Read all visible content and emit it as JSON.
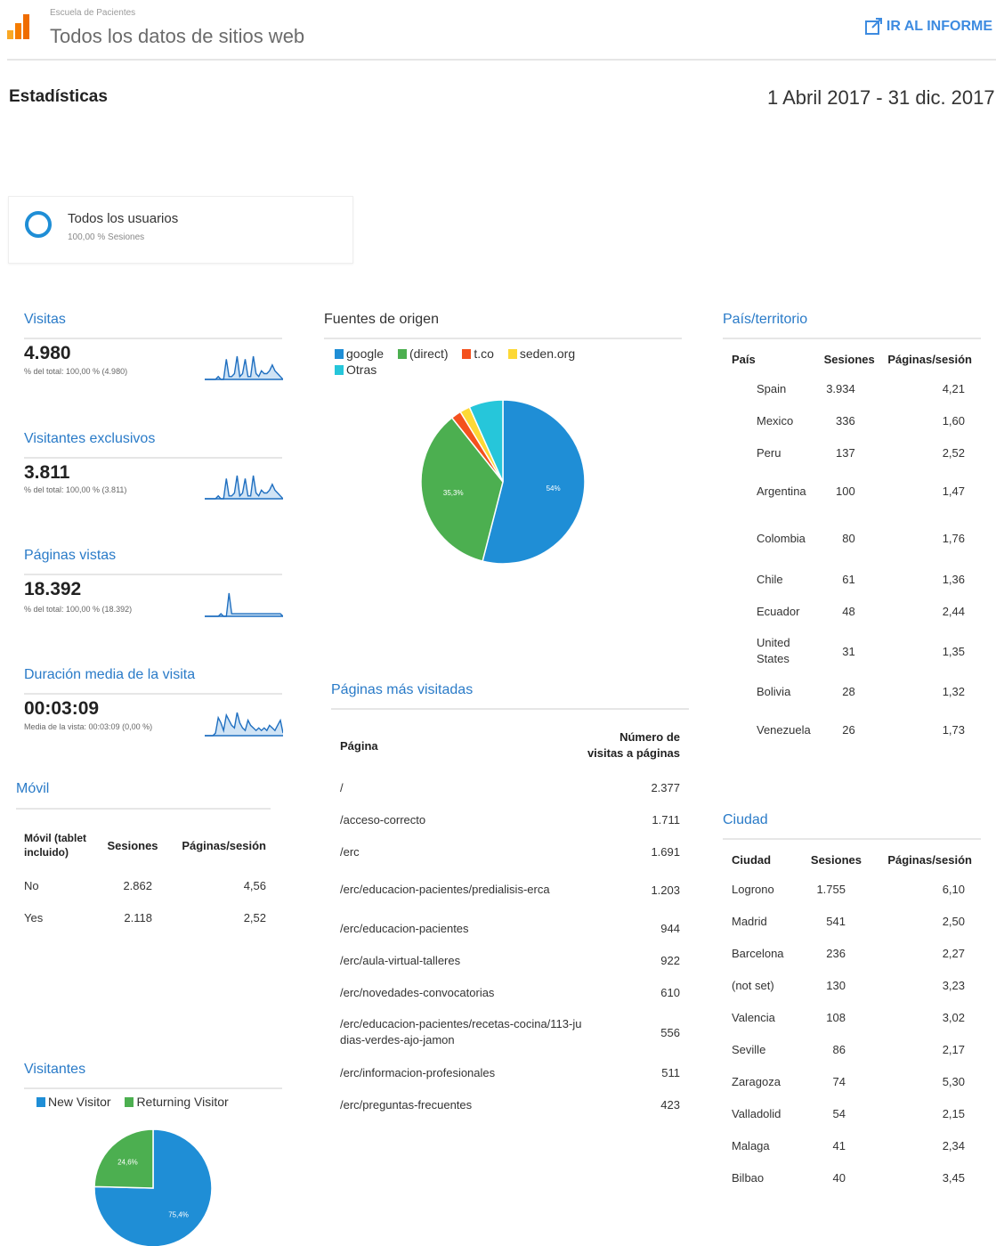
{
  "header": {
    "subtitle": "Escuela de Pacientes",
    "title": "Todos los datos de sitios web",
    "report_link": "IR AL INFORME"
  },
  "stats_label": "Estadísticas",
  "date_range": "1 Abril 2017 - 31 dic. 2017",
  "segment": {
    "name": "Todos los usuarios",
    "pct": "100,00 % Sesiones"
  },
  "metrics": [
    {
      "title": "Visitas",
      "value": "4.980",
      "sub": "% del total: 100,00 % (4.980)"
    },
    {
      "title": "Visitantes exclusivos",
      "value": "3.811",
      "sub": "% del total: 100,00 % (3.811)"
    },
    {
      "title": "Páginas vistas",
      "value": "18.392",
      "sub": "% del total: 100,00 % (18.392)"
    },
    {
      "title": "Duración media de la visita",
      "value": "00:03:09",
      "sub": "Media de la vista: 00:03:09 (0,00 %)"
    }
  ],
  "mobile": {
    "title": "Móvil",
    "headers": [
      "Móvil (tablet incluido)",
      "Sesiones",
      "Páginas/sesión"
    ],
    "rows": [
      [
        "No",
        "2.862",
        "4,56"
      ],
      [
        "Yes",
        "2.118",
        "2,52"
      ]
    ]
  },
  "visitors": {
    "title": "Visitantes",
    "legend": [
      "New Visitor",
      "Returning Visitor"
    ],
    "colors": [
      "#1f8ed6",
      "#4caf50"
    ]
  },
  "sources": {
    "title": "Fuentes de origen",
    "legend": [
      "google",
      "(direct)",
      "t.co",
      "seden.org",
      "Otras"
    ],
    "colors": [
      "#1f8ed6",
      "#4caf50",
      "#f4511e",
      "#fdd835",
      "#26c6da"
    ]
  },
  "top_pages": {
    "title": "Páginas más visitadas",
    "headers": [
      "Página",
      "Número de visitas a páginas"
    ],
    "rows": [
      [
        "/",
        "2.377"
      ],
      [
        "/acceso-correcto",
        "1.711"
      ],
      [
        "/erc",
        "1.691"
      ],
      [
        "/erc/educacion-pacientes/predialisis-erca",
        "1.203"
      ],
      [
        "/erc/educacion-pacientes",
        "944"
      ],
      [
        "/erc/aula-virtual-talleres",
        "922"
      ],
      [
        "/erc/novedades-convocatorias",
        "610"
      ],
      [
        "/erc/educacion-pacientes/recetas-cocina/113-judias-verdes-ajo-jamon",
        "556"
      ],
      [
        "/erc/informacion-profesionales",
        "511"
      ],
      [
        "/erc/preguntas-frecuentes",
        "423"
      ]
    ]
  },
  "country": {
    "title": "País/territorio",
    "headers": [
      "País",
      "Sesiones",
      "Páginas/sesión"
    ],
    "rows": [
      [
        "Spain",
        "3.934",
        "4,21"
      ],
      [
        "Mexico",
        "336",
        "1,60"
      ],
      [
        "Peru",
        "137",
        "2,52"
      ],
      [
        "Argentina",
        "100",
        "1,47"
      ],
      [
        "Colombia",
        "80",
        "1,76"
      ],
      [
        "Chile",
        "61",
        "1,36"
      ],
      [
        "Ecuador",
        "48",
        "2,44"
      ],
      [
        "United States",
        "31",
        "1,35"
      ],
      [
        "Bolivia",
        "28",
        "1,32"
      ],
      [
        "Venezuela",
        "26",
        "1,73"
      ]
    ]
  },
  "city": {
    "title": "Ciudad",
    "headers": [
      "Ciudad",
      "Sesiones",
      "Páginas/sesión"
    ],
    "rows": [
      [
        "Logrono",
        "1.755",
        "6,10"
      ],
      [
        "Madrid",
        "541",
        "2,50"
      ],
      [
        "Barcelona",
        "236",
        "2,27"
      ],
      [
        "(not set)",
        "130",
        "3,23"
      ],
      [
        "Valencia",
        "108",
        "3,02"
      ],
      [
        "Seville",
        "86",
        "2,17"
      ],
      [
        "Zaragoza",
        "74",
        "5,30"
      ],
      [
        "Valladolid",
        "54",
        "2,15"
      ],
      [
        "Malaga",
        "41",
        "2,34"
      ],
      [
        "Bilbao",
        "40",
        "3,45"
      ]
    ]
  },
  "chart_data": [
    {
      "type": "pie",
      "title": "Fuentes de origen",
      "categories": [
        "google",
        "(direct)",
        "t.co",
        "seden.org",
        "Otras"
      ],
      "values": [
        54,
        35.3,
        2,
        2,
        6.7
      ],
      "labels": [
        "54%",
        "35,3%",
        "",
        "",
        ""
      ]
    },
    {
      "type": "pie",
      "title": "Visitantes",
      "categories": [
        "New Visitor",
        "Returning Visitor"
      ],
      "values": [
        75.4,
        24.6
      ],
      "labels": [
        "75,4%",
        "24,6%"
      ]
    },
    {
      "type": "line",
      "title": "Visitas",
      "values": [
        0,
        0,
        0,
        0,
        0,
        1,
        0,
        0,
        7,
        1,
        1,
        2,
        8,
        1,
        2,
        7,
        1,
        1,
        8,
        2,
        1,
        3,
        2,
        2,
        3,
        5,
        3,
        2,
        1,
        0
      ]
    },
    {
      "type": "line",
      "title": "Visitantes exclusivos",
      "values": [
        0,
        0,
        0,
        0,
        0,
        1,
        0,
        0,
        7,
        1,
        1,
        2,
        8,
        1,
        2,
        7,
        1,
        1,
        8,
        2,
        1,
        3,
        2,
        2,
        3,
        5,
        3,
        2,
        1,
        0
      ]
    },
    {
      "type": "line",
      "title": "Páginas vistas",
      "values": [
        0,
        0,
        0,
        0,
        0,
        0,
        1,
        0,
        0,
        9,
        1,
        1,
        1,
        1,
        1,
        1,
        1,
        1,
        1,
        1,
        1,
        1,
        1,
        1,
        1,
        1,
        1,
        1,
        1,
        0
      ]
    },
    {
      "type": "line",
      "title": "Duración media de la visita",
      "values": [
        0,
        0,
        0,
        0,
        1,
        7,
        5,
        2,
        8,
        6,
        4,
        3,
        9,
        5,
        3,
        2,
        6,
        4,
        3,
        2,
        3,
        2,
        3,
        2,
        4,
        3,
        2,
        4,
        6,
        1
      ]
    }
  ]
}
